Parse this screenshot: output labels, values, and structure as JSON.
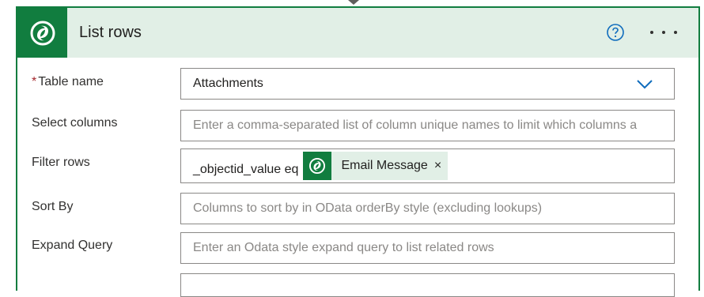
{
  "card": {
    "title": "List rows",
    "help_icon": "help-circle-icon",
    "more_icon": "more-options-icon",
    "accent_color": "#117d3f",
    "header_bg": "#e1efe6"
  },
  "fields": {
    "table_name": {
      "required_mark": "*",
      "label": "Table name",
      "value": "Attachments"
    },
    "select_columns": {
      "label": "Select columns",
      "placeholder": "Enter a comma-separated list of column unique names to limit which columns a"
    },
    "filter_rows": {
      "label": "Filter rows",
      "value_prefix": "_objectid_value eq",
      "token_label": "Email Message",
      "token_close": "×"
    },
    "sort_by": {
      "label": "Sort By",
      "placeholder": "Columns to sort by in OData orderBy style (excluding lookups)"
    },
    "expand_query": {
      "label": "Expand Query",
      "placeholder": "Enter an Odata style expand query to list related rows"
    }
  }
}
